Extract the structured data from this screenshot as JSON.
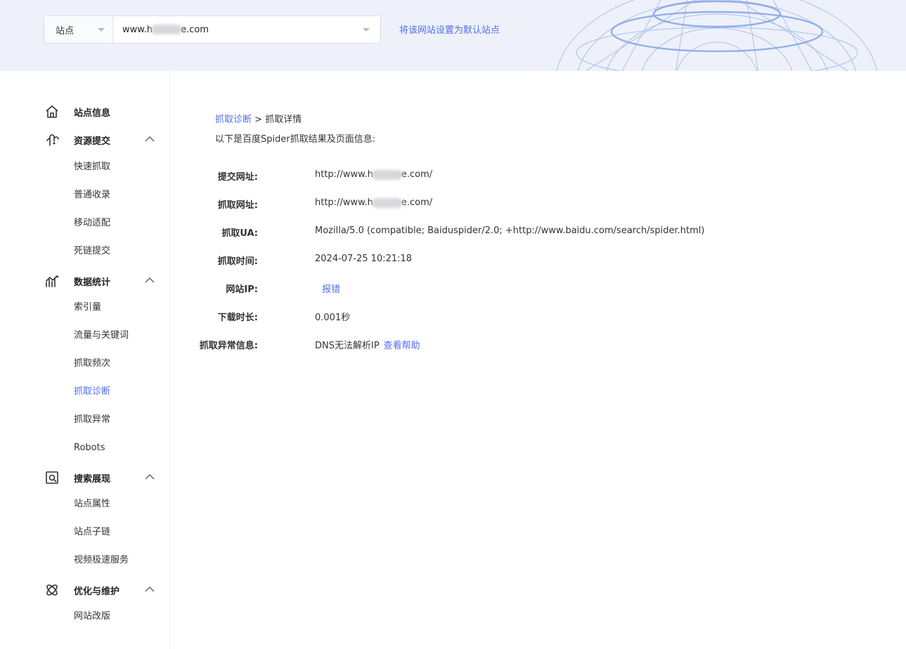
{
  "header": {
    "site_type_label": "站点",
    "site_url_prefix": "www.h",
    "site_url_suffix": "e.com",
    "set_default_link": "将该网站设置为默认站点"
  },
  "sidebar": {
    "groups": [
      {
        "label": "站点信息",
        "icon": "home-icon"
      },
      {
        "label": "资源提交",
        "icon": "submit-icon",
        "items": [
          "快速抓取",
          "普通收录",
          "移动适配",
          "死链提交"
        ]
      },
      {
        "label": "数据统计",
        "icon": "stats-icon",
        "items": [
          "索引量",
          "流量与关键词",
          "抓取频次",
          "抓取诊断",
          "抓取异常",
          "Robots"
        ]
      },
      {
        "label": "搜索展现",
        "icon": "search-display-icon",
        "items": [
          "站点属性",
          "站点子链",
          "视频极速服务"
        ]
      },
      {
        "label": "优化与维护",
        "icon": "atom-icon",
        "items": [
          "网站改版"
        ]
      }
    ],
    "active_item": "抓取诊断"
  },
  "main": {
    "breadcrumb": {
      "link": "抓取诊断",
      "separator": ">",
      "current": "抓取详情"
    },
    "intro": "以下是百度Spider抓取结果及页面信息:",
    "fields": {
      "submit_url": {
        "label": "提交网址:",
        "prefix": "http://www.h",
        "suffix": "e.com/"
      },
      "crawl_url": {
        "label": "抓取网址:",
        "prefix": "http://www.h",
        "suffix": "e.com/"
      },
      "ua": {
        "label": "抓取UA:",
        "value": "Mozilla/5.0 (compatible; Baiduspider/2.0; +http://www.baidu.com/search/spider.html)"
      },
      "time": {
        "label": "抓取时间:",
        "value": "2024-07-25 10:21:18"
      },
      "ip": {
        "label": "网站IP:",
        "report_link": "报错"
      },
      "download": {
        "label": "下载时长:",
        "value": "0.001秒"
      },
      "error": {
        "label": "抓取异常信息:",
        "value": "DNS无法解析IP",
        "help_link": "查看帮助"
      }
    }
  },
  "colors": {
    "accent": "#4e6ef2",
    "banner_bg": "#eef1f9"
  }
}
